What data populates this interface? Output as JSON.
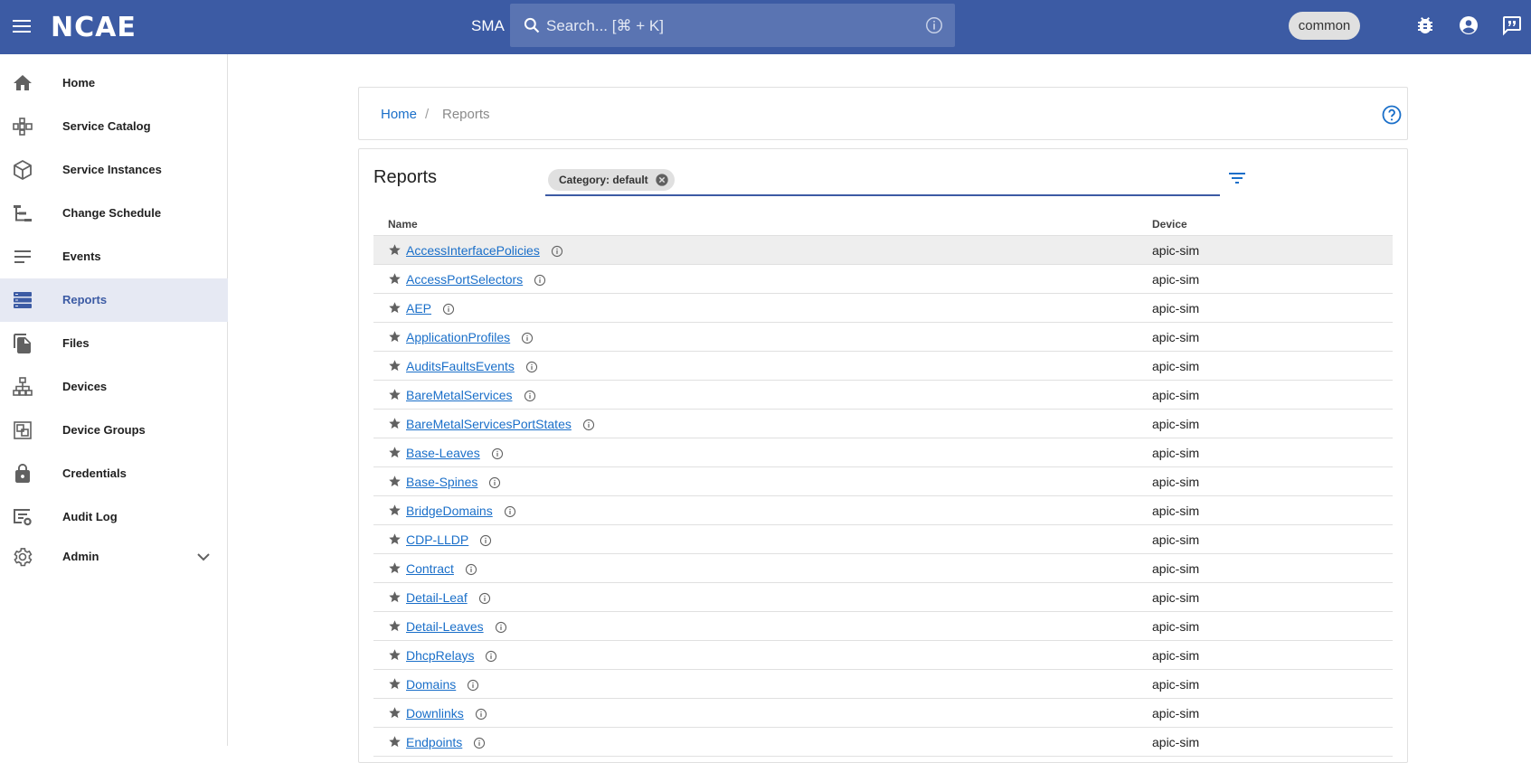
{
  "app": {
    "logo": "NCAE",
    "context": "SMA",
    "tenant": "common"
  },
  "search": {
    "placeholder": "Search... [⌘ + K]"
  },
  "sidebar": {
    "items": [
      {
        "label": "Home",
        "icon": "home-icon"
      },
      {
        "label": "Service Catalog",
        "icon": "service-catalog-icon"
      },
      {
        "label": "Service Instances",
        "icon": "cube-icon"
      },
      {
        "label": "Change Schedule",
        "icon": "tree-icon"
      },
      {
        "label": "Events",
        "icon": "lines-icon"
      },
      {
        "label": "Reports",
        "icon": "reports-icon",
        "active": true
      },
      {
        "label": "Files",
        "icon": "files-icon"
      },
      {
        "label": "Devices",
        "icon": "devices-icon"
      },
      {
        "label": "Device Groups",
        "icon": "device-groups-icon"
      },
      {
        "label": "Credentials",
        "icon": "lock-icon"
      },
      {
        "label": "Audit Log",
        "icon": "audit-log-icon"
      },
      {
        "label": "Admin",
        "icon": "gear-icon",
        "expandable": true
      }
    ]
  },
  "breadcrumb": {
    "home": "Home",
    "separator": "/",
    "current": "Reports"
  },
  "reports": {
    "title": "Reports",
    "filter_chip": "Category: default",
    "columns": {
      "name": "Name",
      "device": "Device"
    },
    "rows": [
      {
        "name": "AccessInterfacePolicies",
        "device": "apic-sim"
      },
      {
        "name": "AccessPortSelectors",
        "device": "apic-sim"
      },
      {
        "name": "AEP",
        "device": "apic-sim"
      },
      {
        "name": "ApplicationProfiles",
        "device": "apic-sim"
      },
      {
        "name": "AuditsFaultsEvents",
        "device": "apic-sim"
      },
      {
        "name": "BareMetalServices",
        "device": "apic-sim"
      },
      {
        "name": "BareMetalServicesPortStates",
        "device": "apic-sim"
      },
      {
        "name": "Base-Leaves",
        "device": "apic-sim"
      },
      {
        "name": "Base-Spines",
        "device": "apic-sim"
      },
      {
        "name": "BridgeDomains",
        "device": "apic-sim"
      },
      {
        "name": "CDP-LLDP",
        "device": "apic-sim"
      },
      {
        "name": "Contract",
        "device": "apic-sim"
      },
      {
        "name": "Detail-Leaf",
        "device": "apic-sim"
      },
      {
        "name": "Detail-Leaves",
        "device": "apic-sim"
      },
      {
        "name": "DhcpRelays",
        "device": "apic-sim"
      },
      {
        "name": "Domains",
        "device": "apic-sim"
      },
      {
        "name": "Downlinks",
        "device": "apic-sim"
      },
      {
        "name": "Endpoints",
        "device": "apic-sim"
      }
    ]
  },
  "colors": {
    "topbar": "#3c5ba4",
    "link": "#1a6fc9",
    "active_nav": "#e6e9f3"
  }
}
